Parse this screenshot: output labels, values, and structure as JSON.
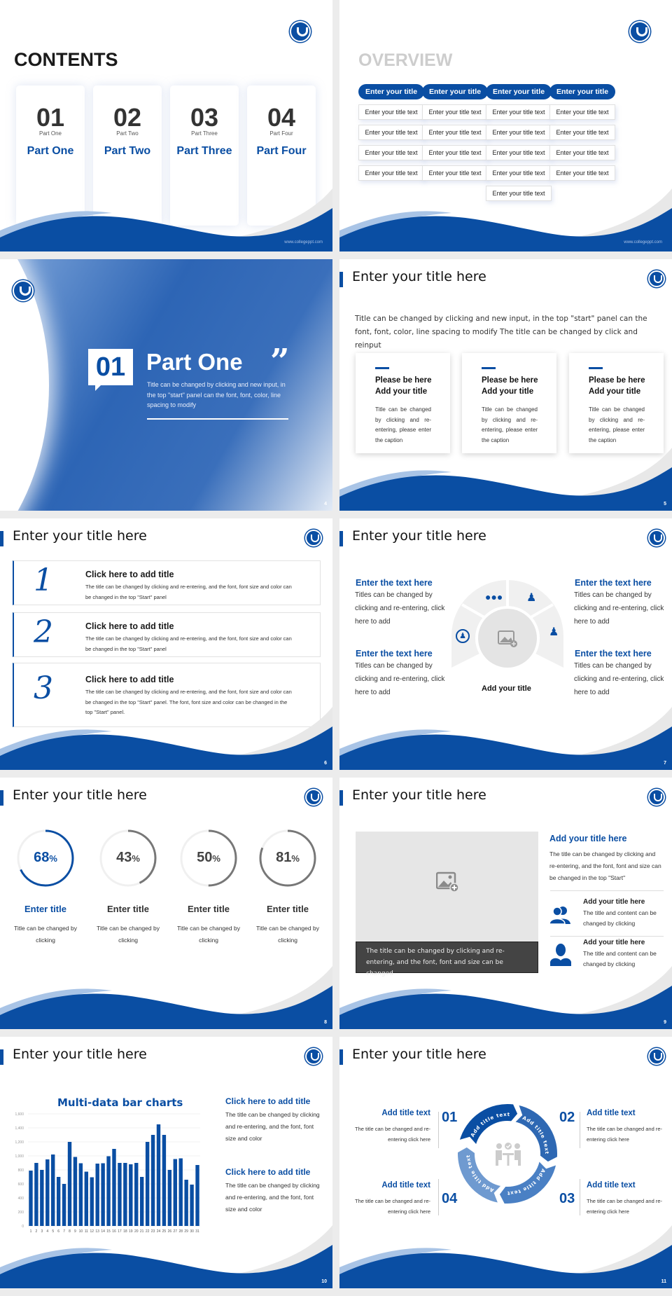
{
  "theme": {
    "accent": "#0a4ea3",
    "light_accent": "#a9c4e6",
    "background": "#ececec"
  },
  "footer_url": "www.collegeppt.com",
  "slide1": {
    "title": "CONTENTS",
    "cards": [
      {
        "number": "01",
        "subtitle": "Part One",
        "label": "Part One"
      },
      {
        "number": "02",
        "subtitle": "Part Two",
        "label": "Part Two"
      },
      {
        "number": "03",
        "subtitle": "Part Three",
        "label": "Part Three"
      },
      {
        "number": "04",
        "subtitle": "Part Four",
        "label": "Part Four"
      }
    ]
  },
  "slide2": {
    "title": "OVERVIEW",
    "columns": [
      {
        "header": "Enter your title",
        "items": [
          "Enter your title text",
          "Enter your title text",
          "Enter your title text",
          "Enter your title text"
        ]
      },
      {
        "header": "Enter your title",
        "items": [
          "Enter your title text",
          "Enter your title text",
          "Enter your title text",
          "Enter your title text"
        ]
      },
      {
        "header": "Enter your title",
        "items": [
          "Enter your title text",
          "Enter your title text",
          "Enter your title text",
          "Enter your title text",
          "Enter your title text"
        ]
      },
      {
        "header": "Enter your title",
        "items": [
          "Enter your title text",
          "Enter your title text",
          "Enter your title text",
          "Enter your title text"
        ]
      }
    ]
  },
  "slide4": {
    "number": "01",
    "title": "Part One",
    "quote_mark": "”",
    "description": "Title can be changed by clicking and new input, in the top \"start\" panel can the font, font, color, line spacing to modify",
    "page": "4"
  },
  "slide5": {
    "title": "Enter your title here",
    "intro": "Title can be changed by clicking and new input, in the top \"start\" panel can the font, font, color, line spacing to modify The title can be changed by click and reinput",
    "cards": [
      {
        "title_line1": "Please be here",
        "title_line2": "Add your title",
        "desc": "Title can be changed by clicking and re-entering, please enter the caption"
      },
      {
        "title_line1": "Please be here",
        "title_line2": "Add your title",
        "desc": "Title can be changed by clicking and re-entering, please enter the caption"
      },
      {
        "title_line1": "Please be here",
        "title_line2": "Add your title",
        "desc": "Title can be changed by clicking and re-entering, please enter the caption"
      }
    ],
    "page": "5"
  },
  "slide6": {
    "title": "Enter your title here",
    "rows": [
      {
        "number": "1",
        "title": "Click here to add title",
        "desc": "The title can be changed by clicking and re-entering, and the font, font size and color can be changed in the top \"Start\" panel"
      },
      {
        "number": "2",
        "title": "Click here to add title",
        "desc": "The title can be changed by clicking and re-entering, and the font, font size and color can be changed in the top \"Start\" panel"
      },
      {
        "number": "3",
        "title": "Click here to add title",
        "desc": "The title can be changed by clicking and re-entering, and the font, font size and color can be changed in the top \"Start\" panel. The font, font size and color can be changed in the top \"Start\" panel."
      }
    ],
    "page": "6"
  },
  "slide7": {
    "title": "Enter your title here",
    "blocks": [
      {
        "heading": "Enter the text here",
        "desc": "Titles can be changed by clicking and re-entering, click here to add"
      },
      {
        "heading": "Enter the text here",
        "desc": "Titles can be changed by clicking and re-entering, click here to add"
      },
      {
        "heading": "Enter the text here",
        "desc": "Titles can be changed by clicking and re-entering, click here to add"
      },
      {
        "heading": "Enter the text here",
        "desc": "Titles can be changed by clicking and re-entering, click here to add"
      }
    ],
    "icons": [
      "team-icon",
      "user-chat-icon",
      "reader-icon",
      "user-cycle-icon"
    ],
    "center_caption": "Add your title",
    "page": "7"
  },
  "slide8": {
    "title": "Enter your title here",
    "stats": [
      {
        "value": 68,
        "label": "68",
        "unit": "%",
        "title": "Enter title",
        "desc": "Title can be changed by clicking",
        "color": "#0a4ea3"
      },
      {
        "value": 43,
        "label": "43",
        "unit": "%",
        "title": "Enter title",
        "desc": "Title can be changed by clicking",
        "color": "#777777"
      },
      {
        "value": 50,
        "label": "50",
        "unit": "%",
        "title": "Enter title",
        "desc": "Title can be changed by clicking",
        "color": "#777777"
      },
      {
        "value": 81,
        "label": "81",
        "unit": "%",
        "title": "Enter title",
        "desc": "Title can be changed by clicking",
        "color": "#777777"
      }
    ],
    "page": "8"
  },
  "slide9": {
    "title": "Enter your title here",
    "image_caption": "The title can be changed by clicking and re-entering, and the font, font and size can be changed",
    "heading": "Add your title here",
    "desc": "The title can be changed by clicking and re-entering, and the font, font and size can be changed in the top \"Start\"",
    "items": [
      {
        "icon": "group-icon",
        "title": "Add your title here",
        "desc": "The title and content can be changed by clicking"
      },
      {
        "icon": "person-icon",
        "title": "Add your title here",
        "desc": "The title and content can be changed by clicking"
      }
    ],
    "page": "9"
  },
  "slide10": {
    "title": "Enter your title here",
    "side": [
      {
        "heading": "Click here to add title",
        "desc": "The title can be changed by clicking and re-entering, and the font, font size and color"
      },
      {
        "heading": "Click here to add title",
        "desc": "The title can be changed by clicking and re-entering, and the font, font size and color"
      }
    ],
    "page": "10"
  },
  "chart_data": {
    "type": "bar",
    "title": "Multi-data bar charts",
    "xlabel": "",
    "ylabel": "",
    "categories": [
      "1",
      "2",
      "3",
      "4",
      "5",
      "6",
      "7",
      "8",
      "9",
      "10",
      "11",
      "12",
      "13",
      "14",
      "15",
      "16",
      "17",
      "18",
      "19",
      "20",
      "21",
      "22",
      "23",
      "24",
      "25",
      "26",
      "27",
      "28",
      "29",
      "30",
      "31"
    ],
    "values": [
      790,
      900,
      800,
      950,
      1020,
      700,
      600,
      1200,
      985,
      895,
      775,
      695,
      890,
      895,
      995,
      1100,
      900,
      900,
      880,
      900,
      700,
      1200,
      1300,
      1450,
      1300,
      800,
      955,
      965,
      660,
      590,
      870
    ],
    "yticks": [
      "0",
      "200",
      "400",
      "600",
      "800",
      "1,000",
      "1,200",
      "1,400",
      "1,600"
    ],
    "ylim": [
      0,
      1600
    ],
    "grid": true,
    "color": "#0a4ea3"
  },
  "slide11": {
    "title": "Enter your title here",
    "steps": [
      {
        "number": "01",
        "heading": "Add title text",
        "desc": "The title can be changed and re-entering click here",
        "ring_label": "Add title text"
      },
      {
        "number": "02",
        "heading": "Add title text",
        "desc": "The title can be changed and re-entering click here",
        "ring_label": "Add title text"
      },
      {
        "number": "03",
        "heading": "Add title text",
        "desc": "The title can be changed and re-entering click here",
        "ring_label": "Add title text"
      },
      {
        "number": "04",
        "heading": "Add title text",
        "desc": "The title can be changed and re-entering click here",
        "ring_label": "Add title text"
      }
    ],
    "ring_colors": [
      "#0a4ea3",
      "#2e68b3",
      "#4a80c4",
      "#6f9ad0"
    ],
    "page": "11"
  }
}
